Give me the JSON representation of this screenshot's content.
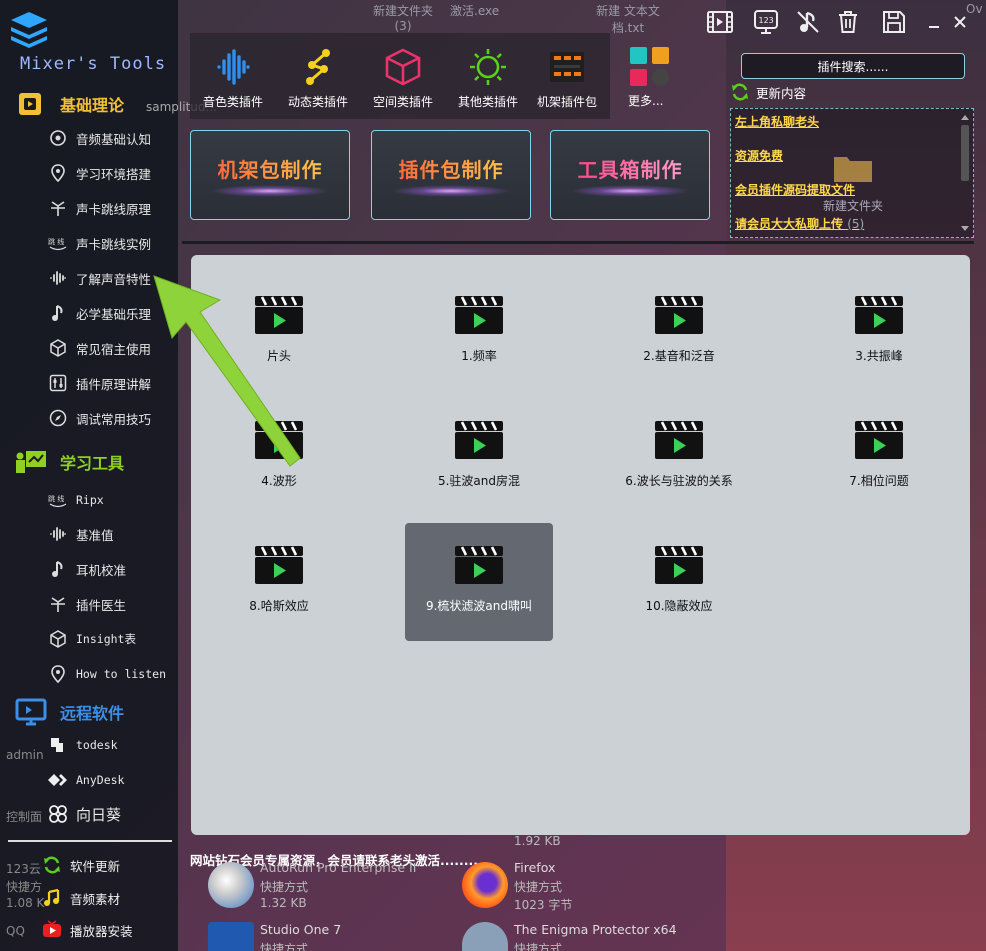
{
  "app": {
    "name": "Mixer's Tools"
  },
  "sidebar": {
    "sections": [
      {
        "label": "基础理论",
        "color": "#f2c033"
      },
      {
        "label": "学习工具",
        "color": "#8fd020"
      },
      {
        "label": "远程软件",
        "color": "#3b8fe8"
      }
    ],
    "basics": [
      {
        "label": "音频基础认知",
        "icon": "brain-gear-icon"
      },
      {
        "label": "学习环境搭建",
        "icon": "location-pin-icon"
      },
      {
        "label": "声卡跳线原理",
        "icon": "split-arrow-icon"
      },
      {
        "label": "声卡跳线实例",
        "icon": "jumper-icon"
      },
      {
        "label": "了解声音特性",
        "icon": "waveform-icon"
      },
      {
        "label": "必学基础乐理",
        "icon": "music-note-icon"
      },
      {
        "label": "常见宿主使用",
        "icon": "cube-icon"
      },
      {
        "label": "插件原理讲解",
        "icon": "sliders-icon"
      },
      {
        "label": "调试常用技巧",
        "icon": "compass-icon"
      }
    ],
    "tools": [
      {
        "label": "Ripx",
        "icon": "jumper-icon"
      },
      {
        "label": "基准值",
        "icon": "waveform-icon"
      },
      {
        "label": "耳机校准",
        "icon": "music-note-icon"
      },
      {
        "label": "插件医生",
        "icon": "split-arrow-icon"
      },
      {
        "label": "Insight表",
        "icon": "cube-icon"
      },
      {
        "label": "How to listen",
        "icon": "location-pin-icon"
      }
    ],
    "remote": [
      {
        "label": "todesk",
        "icon": "todesk-icon"
      },
      {
        "label": "AnyDesk",
        "icon": "anydesk-icon"
      },
      {
        "label": "向日葵",
        "icon": "sunflower-icon"
      }
    ],
    "bottom": [
      {
        "label": "软件更新",
        "icon": "refresh-icon"
      },
      {
        "label": "音频素材",
        "icon": "music-note-icon"
      },
      {
        "label": "播放器安装",
        "icon": "youtube-icon"
      }
    ]
  },
  "categories": [
    {
      "label": "音色类插件",
      "icon": "waveform-icon",
      "color": "#2f8ff0"
    },
    {
      "label": "动态类插件",
      "icon": "nodes-icon",
      "color": "#f5d21a"
    },
    {
      "label": "空间类插件",
      "icon": "cube-icon",
      "color": "#e8346a"
    },
    {
      "label": "其他类插件",
      "icon": "sun-icon",
      "color": "#5ad01a"
    },
    {
      "label": "机架插件包",
      "icon": "rack-icon",
      "color": "#f07a1a"
    }
  ],
  "more_label": "更多...",
  "desktop": {
    "new_folder_3": "新建文件夹",
    "new_folder_3_count": "(3)",
    "activate": "激活.exe",
    "new_text_a": "新建 文本文",
    "new_text_b": "档.txt",
    "ov": "Ov",
    "samplitude": "samplitud...",
    "new_folder": "新建文件夹",
    "size_192": "1.92 KB",
    "autorun": "AutoRun Pro Enterprise II",
    "shortcut": "快捷方式",
    "size_132": "1.32 KB",
    "firefox": "Firefox",
    "size_1023": "1023 字节",
    "studio_one": "Studio One 7",
    "enigma": "The Enigma Protector x64",
    "admin": "admin",
    "control": "控制面",
    "yun": "123云",
    "kuai": "快捷方",
    "size_108": "1.08 K",
    "qq": "QQ"
  },
  "search": {
    "label": "插件搜索......"
  },
  "updates": {
    "title": "更新内容",
    "items": [
      {
        "text": "左上角私聊老头",
        "count": ""
      },
      {
        "text": "资源免费",
        "count": ""
      },
      {
        "text": "会员插件源码提取文件",
        "count": ""
      },
      {
        "text": "请会员大大私聊上传",
        "count": "(5)"
      }
    ]
  },
  "banners": [
    {
      "title": "机架包制作"
    },
    {
      "title": "插件包制作"
    },
    {
      "title": "工具箱制作"
    }
  ],
  "videos": [
    {
      "label": "片头"
    },
    {
      "label": "1.频率"
    },
    {
      "label": "2.基音和泛音"
    },
    {
      "label": "3.共振峰"
    },
    {
      "label": "4.波形"
    },
    {
      "label": "5.驻波and房混"
    },
    {
      "label": "6.波长与驻波的关系"
    },
    {
      "label": "7.相位问题"
    },
    {
      "label": "8.哈斯效应"
    },
    {
      "label": "9.梳状滤波and啸叫"
    },
    {
      "label": "10.隐蔽效应"
    }
  ],
  "selected_video": 9,
  "notice": "网站钻石会员专属资源，会员请联系老头激活........",
  "toolbar_icons": [
    "video-icon",
    "keypad-123-icon",
    "mute-note-icon",
    "trash-icon",
    "save-icon",
    "minimize-icon",
    "close-icon"
  ]
}
